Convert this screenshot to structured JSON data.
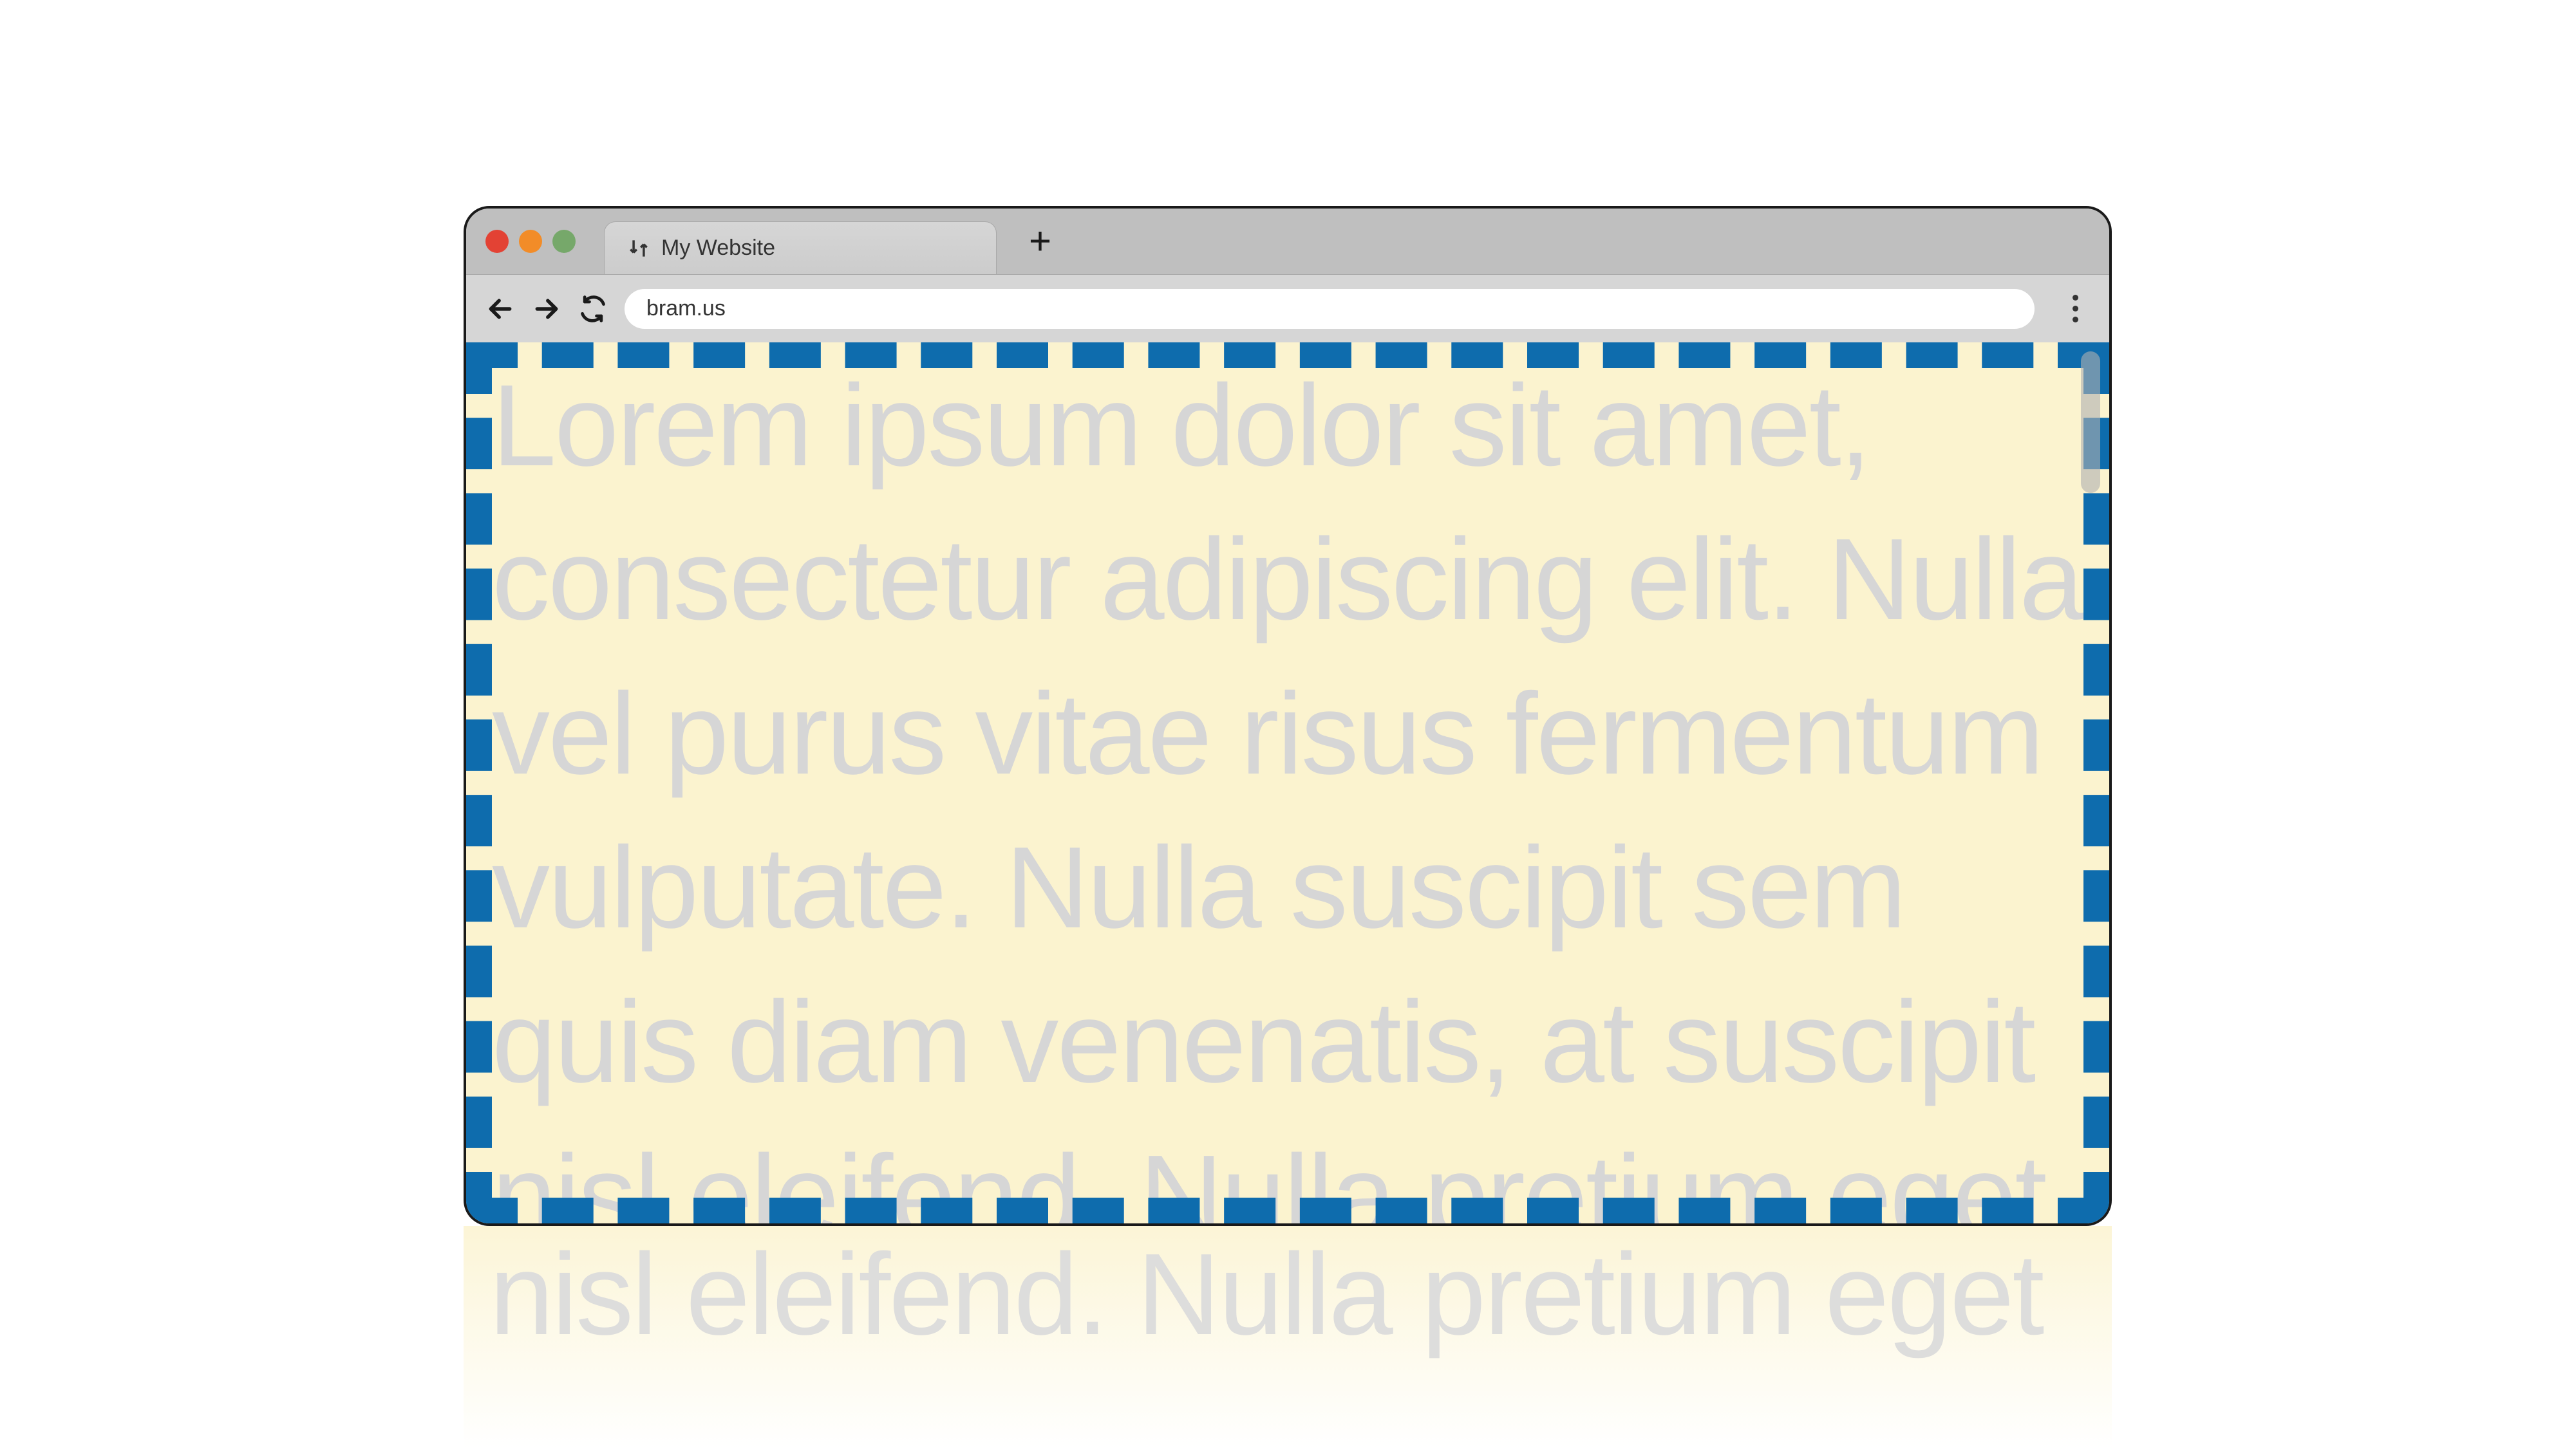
{
  "browser": {
    "tab": {
      "title": "My Website",
      "icon_glyph": "⇵"
    },
    "new_tab_glyph": "+",
    "address": "bram.us"
  },
  "page": {
    "body_text": "Lorem ipsum dolor sit amet, consectetur adipiscing elit. Nulla vel purus vitae risus fermentum vulputate. Nulla suscipit sem quis diam venenatis, at suscipit nisl eleifend. Nulla pretium eget",
    "background_color": "#fbf3cf",
    "text_color": "#d6d6d6",
    "dashed_border_color": "#0e6cad"
  }
}
